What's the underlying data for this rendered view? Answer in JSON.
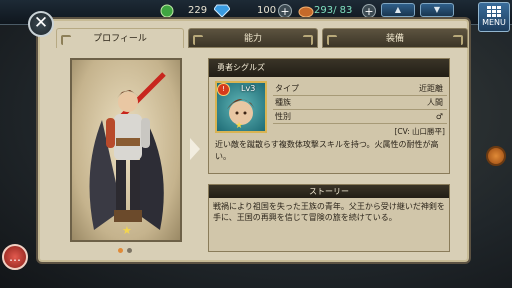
{
  "topbar": {
    "coins": "229",
    "gems": "100",
    "stamina": "293/ 83",
    "menu_label": "MENU"
  },
  "tabs": [
    {
      "label": "プロフィール",
      "active": true
    },
    {
      "label": "能力",
      "active": false
    },
    {
      "label": "装備",
      "active": false
    }
  ],
  "character": {
    "name": "勇者シグルズ",
    "level": "Lv3",
    "stats": [
      {
        "key": "タイプ",
        "value": "近距離"
      },
      {
        "key": "種族",
        "value": "人間"
      },
      {
        "key": "性別",
        "value": "♂"
      }
    ],
    "cv": "[CV: 山口勝平]",
    "description": "近い敵を蹴散らす複数体攻撃スキルを持つ。火属性の耐性が高い。"
  },
  "story": {
    "title": "ストーリー",
    "text": "戦禍により祖国を失った王族の青年。父王から受け継いだ神剣を手に、王国の再興を信じて冒険の旅を続けている。"
  },
  "pager": {
    "pages": 2,
    "current": 1
  },
  "colors": {
    "accent": "#d8cfb6",
    "header": "#2b2418"
  }
}
